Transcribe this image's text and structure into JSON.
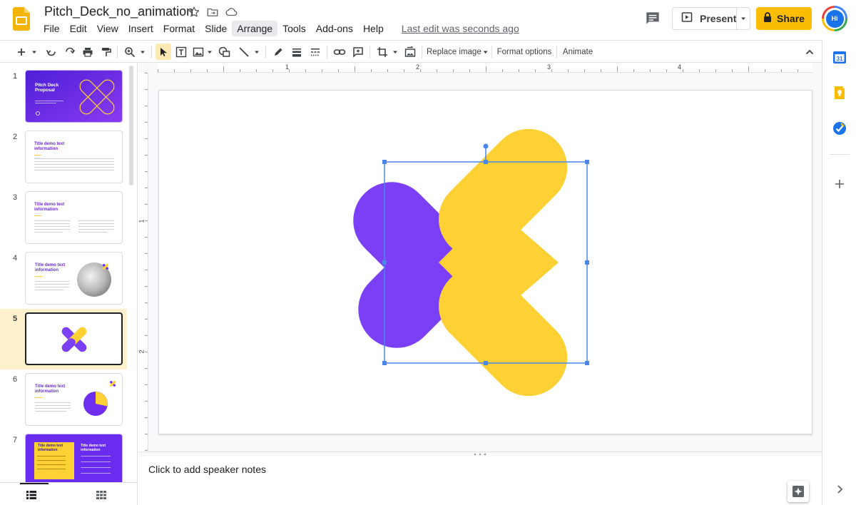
{
  "header": {
    "doc_title": "Pitch_Deck_no_animation",
    "menu": [
      "File",
      "Edit",
      "View",
      "Insert",
      "Format",
      "Slide",
      "Arrange",
      "Tools",
      "Add-ons",
      "Help"
    ],
    "hovered_menu": "Arrange",
    "last_edit": "Last edit was seconds ago",
    "present_label": "Present",
    "share_label": "Share",
    "avatar_initials": "Hi"
  },
  "toolbar": {
    "replace_image_label": "Replace image",
    "format_options_label": "Format options",
    "animate_label": "Animate"
  },
  "ruler": {
    "horizontal": [
      "1",
      "2",
      "3",
      "4"
    ],
    "vertical": [
      "1",
      "2"
    ]
  },
  "filmstrip": {
    "selected_slide": 5,
    "slides": [
      {
        "number": "1",
        "title": "Pitch Deck Proposal"
      },
      {
        "number": "2",
        "title": "Title demo text information"
      },
      {
        "number": "3",
        "title": "Title demo text information"
      },
      {
        "number": "4",
        "title": "Title demo text information"
      },
      {
        "number": "5",
        "title": ""
      },
      {
        "number": "6",
        "title": "Title demo text information"
      },
      {
        "number": "7",
        "title": "Title demo text information"
      }
    ]
  },
  "notes": {
    "placeholder": "Click to add speaker notes"
  },
  "colors": {
    "brand_purple": "#6f2df0",
    "brand_yellow": "#fdd034",
    "selection_blue": "#4a86e8",
    "share_yellow": "#fbbc04"
  },
  "icons": [
    "docs-slides-logo",
    "star-icon",
    "move-folder-icon",
    "cloud-status-icon",
    "comment-icon",
    "present-icon",
    "lock-icon",
    "calendar-icon",
    "keep-icon",
    "tasks-icon",
    "plus-icon"
  ]
}
